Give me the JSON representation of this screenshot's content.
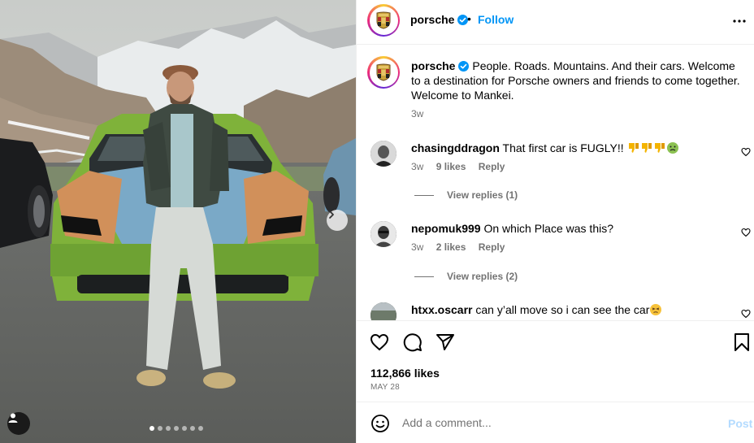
{
  "post": {
    "username": "porsche",
    "separator": "•",
    "follow_label": "Follow",
    "more_icon": "more-horizontal-icon",
    "avatar_icon": "porsche-crest-icon"
  },
  "media": {
    "carousel_total": 7,
    "carousel_active": 1,
    "next_icon": "chevron-right-icon",
    "tag_icon": "user-tag-icon"
  },
  "caption": {
    "username": "porsche",
    "text": "People. Roads. Mountains. And their cars. Welcome to a destination for Porsche owners and friends to come together. Welcome to Mankei.",
    "time": "3w"
  },
  "comments": [
    {
      "username": "chasingddragon",
      "text": "That first car is FUGLY!!",
      "emojis": [
        "thumbs-down-icon",
        "thumbs-down-icon",
        "thumbs-down-icon",
        "nauseated-face-icon"
      ],
      "time": "3w",
      "likes": "9 likes",
      "reply_label": "Reply",
      "view_replies": "View replies (1)"
    },
    {
      "username": "nepomuk999",
      "text": "On which Place was this?",
      "emojis": [],
      "time": "3w",
      "likes": "2 likes",
      "reply_label": "Reply",
      "view_replies": "View replies (2)"
    },
    {
      "username": "htxx.oscarr",
      "text": "can y’all move so i can see the car",
      "emojis": [
        "persevering-face-icon"
      ],
      "time": "",
      "likes": "",
      "reply_label": "",
      "view_replies": ""
    }
  ],
  "actions": {
    "like_icon": "heart-icon",
    "comment_icon": "comment-icon",
    "share_icon": "share-icon",
    "save_icon": "bookmark-icon",
    "likes_count": "112,866 likes",
    "date": "MAY 28"
  },
  "add_comment": {
    "placeholder": "Add a comment...",
    "post_label": "Post",
    "emoji_icon": "smiley-icon"
  },
  "colors": {
    "accent": "#0095f6",
    "post_disabled": "#b3dbff",
    "muted": "#737373",
    "divider": "#efefef"
  }
}
